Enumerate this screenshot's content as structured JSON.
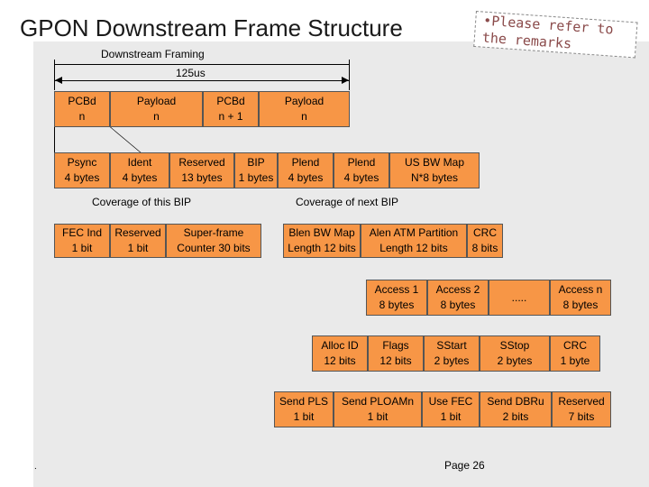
{
  "title": "GPON Downstream Frame Structure",
  "note": {
    "line1": "•Please refer to",
    "line2": "the remarks"
  },
  "framing": {
    "label": "Downstream Framing",
    "duration": "125us"
  },
  "row1": [
    {
      "l1": "PCBd",
      "l2": "n"
    },
    {
      "l1": "Payload",
      "l2": "n"
    },
    {
      "l1": "PCBd",
      "l2": "n + 1"
    },
    {
      "l1": "Payload",
      "l2": "n"
    }
  ],
  "row2": [
    {
      "l1": "Psync",
      "l2": "4 bytes"
    },
    {
      "l1": "Ident",
      "l2": "4 bytes"
    },
    {
      "l1": "Reserved",
      "l2": "13 bytes"
    },
    {
      "l1": "BIP",
      "l2": "1 bytes"
    },
    {
      "l1": "Plend",
      "l2": "4 bytes"
    },
    {
      "l1": "Plend",
      "l2": "4 bytes"
    },
    {
      "l1": "US BW Map",
      "l2": "N*8 bytes"
    }
  ],
  "coverage": {
    "this_bip": "Coverage of this BIP",
    "next_bip": "Coverage of next BIP"
  },
  "row3_left": [
    {
      "l1": "FEC Ind",
      "l2": "1 bit"
    },
    {
      "l1": "Reserved",
      "l2": "1 bit"
    },
    {
      "l1": "Super-frame",
      "l2": "Counter 30 bits"
    }
  ],
  "row3_right": [
    {
      "l1": "Blen BW Map",
      "l2": "Length 12 bits"
    },
    {
      "l1": "Alen ATM Partition",
      "l2": "Length 12 bits"
    },
    {
      "l1": "CRC",
      "l2": "8 bits"
    }
  ],
  "row4": [
    {
      "l1": "Access 1",
      "l2": "8 bytes"
    },
    {
      "l1": "Access 2",
      "l2": "8 bytes"
    },
    {
      "l1": ".....",
      "l2": ""
    },
    {
      "l1": "Access n",
      "l2": "8 bytes"
    }
  ],
  "row5": [
    {
      "l1": "Alloc ID",
      "l2": "12 bits"
    },
    {
      "l1": "Flags",
      "l2": "12 bits"
    },
    {
      "l1": "SStart",
      "l2": "2 bytes"
    },
    {
      "l1": "SStop",
      "l2": "2 bytes"
    },
    {
      "l1": "CRC",
      "l2": "1 byte"
    }
  ],
  "row6": [
    {
      "l1": "Send PLS",
      "l2": "1 bit"
    },
    {
      "l1": "Send PLOAMn",
      "l2": "1 bit"
    },
    {
      "l1": "Use FEC",
      "l2": "1 bit"
    },
    {
      "l1": "Send DBRu",
      "l2": "2 bits"
    },
    {
      "l1": "Reserved",
      "l2": "7 bits"
    }
  ],
  "footer": {
    "page": "Page 26",
    "dot": "."
  }
}
